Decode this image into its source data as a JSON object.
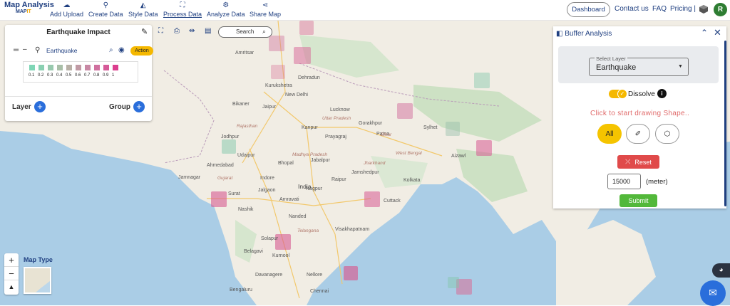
{
  "header": {
    "brand_title": "Map Analysis",
    "brand_sub_left": "MAP",
    "brand_sub_right": "IT",
    "nav": [
      {
        "label": "Add Upload",
        "icon": "cloud-upload-icon"
      },
      {
        "label": "Create Data",
        "icon": "pin-icon"
      },
      {
        "label": "Style Data",
        "icon": "paint-bucket-icon"
      },
      {
        "label": "Process Data",
        "icon": "process-icon"
      },
      {
        "label": "Analyze Data",
        "icon": "analyze-icon"
      },
      {
        "label": "Share Map",
        "icon": "share-icon"
      }
    ],
    "dashboard_label": "Dashboard",
    "contact_label": "Contact us",
    "faq_label": "FAQ",
    "pricing_label": "Pricing |",
    "avatar_letter": "R"
  },
  "layer_panel": {
    "title": "Earthquake Impact",
    "layer_name": "Earthquake",
    "action_label": "Action",
    "legend_values": [
      "0.1",
      "0.2",
      "0.3",
      "0.4",
      "0.5",
      "0.6",
      "0.7",
      "0.8",
      "0.9",
      "1"
    ],
    "legend_colors": [
      "#7fd6b6",
      "#8ad0b2",
      "#98c9ae",
      "#a9bfa8",
      "#b8b0a6",
      "#c09aa4",
      "#c888a4",
      "#d0709f",
      "#d65a98",
      "#dc3e8e"
    ],
    "layer_label": "Layer",
    "group_label": "Group"
  },
  "toolbar": {
    "search_label": "Search"
  },
  "buffer_panel": {
    "title": "Buffer Analysis",
    "select_label": "Select Layer",
    "select_value": "Earthquake",
    "dissolve_label": "Dissolve",
    "draw_hint": "Click to start drawing Shape..",
    "all_label": "All",
    "reset_label": "Reset",
    "distance_value": "15000",
    "unit_label": "(meter)",
    "submit_label": "Submit"
  },
  "map_controls": {
    "zoom_in": "+",
    "zoom_out": "−",
    "reset_north": "▲",
    "map_type_label": "Map Type"
  },
  "map_labels": [
    {
      "text": "Dehradun"
    },
    {
      "text": "Kurukshetra"
    },
    {
      "text": "New Delhi"
    },
    {
      "text": "Bikaner"
    },
    {
      "text": "Jaipur"
    },
    {
      "text": "Uttar Pradesh"
    },
    {
      "text": "Lucknow"
    },
    {
      "text": "Gorakhpur"
    },
    {
      "text": "Kanpur"
    },
    {
      "text": "Prayagraj"
    },
    {
      "text": "Patna"
    },
    {
      "text": "Bihar"
    },
    {
      "text": "Rajasthan"
    },
    {
      "text": "Jodhpur"
    },
    {
      "text": "Udaipur"
    },
    {
      "text": "Ahmedabad"
    },
    {
      "text": "Gujarat"
    },
    {
      "text": "Jamnagar"
    },
    {
      "text": "Bhopal"
    },
    {
      "text": "Jabalpur"
    },
    {
      "text": "Madhya Pradesh"
    },
    {
      "text": "Raipur"
    },
    {
      "text": "Jharkhand"
    },
    {
      "text": "Jamshedpur"
    },
    {
      "text": "West Bengal"
    },
    {
      "text": "Kolkata"
    },
    {
      "text": "Indore"
    },
    {
      "text": "Surat"
    },
    {
      "text": "Jalgaon"
    },
    {
      "text": "India"
    },
    {
      "text": "Nagpur"
    },
    {
      "text": "Amravati"
    },
    {
      "text": "Nashik"
    },
    {
      "text": "Nanded"
    },
    {
      "text": "Telangana"
    },
    {
      "text": "Visakhapatnam"
    },
    {
      "text": "Cuttack"
    },
    {
      "text": "Solapur"
    },
    {
      "text": "Kurnool"
    },
    {
      "text": "Belagavi"
    },
    {
      "text": "Davanagere"
    },
    {
      "text": "Nellore"
    },
    {
      "text": "Chennai"
    },
    {
      "text": "Bengaluru"
    },
    {
      "text": "Aizawl"
    },
    {
      "text": "Amritsar"
    },
    {
      "text": "Sylhet"
    }
  ]
}
